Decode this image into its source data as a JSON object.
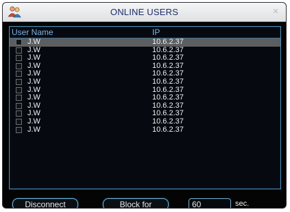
{
  "window": {
    "title": "ONLINE USERS",
    "icon": "users-icon",
    "close": "×"
  },
  "table": {
    "columns": [
      "User Name",
      "IP"
    ],
    "rows": [
      {
        "name": "J.W",
        "ip": "10.6.2.37",
        "selected": true
      },
      {
        "name": "J.W",
        "ip": "10.6.2.37"
      },
      {
        "name": "J.W",
        "ip": "10.6.2.37"
      },
      {
        "name": "J.W",
        "ip": "10.6.2.37"
      },
      {
        "name": "J.W",
        "ip": "10.6.2.37"
      },
      {
        "name": "J.W",
        "ip": "10.6.2.37"
      },
      {
        "name": "J.W",
        "ip": "10.6.2.37"
      },
      {
        "name": "J.W",
        "ip": "10.6.2.37"
      },
      {
        "name": "J.W",
        "ip": "10.6.2.37"
      },
      {
        "name": "J.W",
        "ip": "10.6.2.37"
      },
      {
        "name": "J.W",
        "ip": "10.6.2.37"
      },
      {
        "name": "J.W",
        "ip": "10.6.2.37"
      }
    ]
  },
  "footer": {
    "disconnect_label": "Disconnect",
    "block_label": "Block for",
    "block_seconds": "60",
    "seconds_unit": "sec."
  },
  "colors": {
    "background": "#040404",
    "border": "#4a8eb8",
    "header_text": "#7fb3e0",
    "selected_row": "#5c5e60",
    "title_text": "#1e2c6a"
  }
}
